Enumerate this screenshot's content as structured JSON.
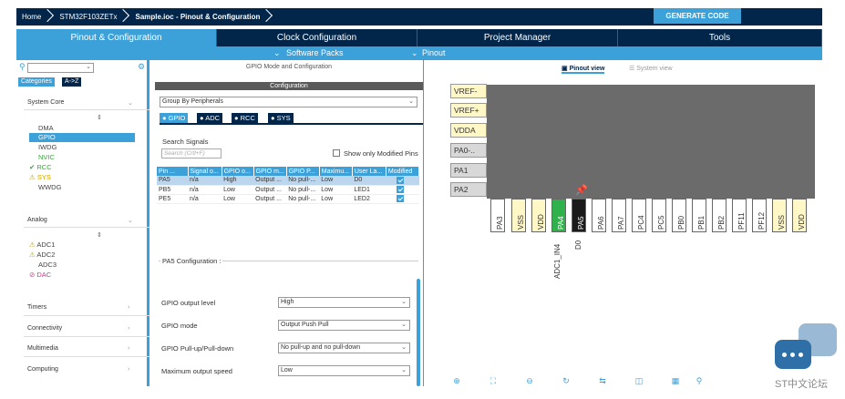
{
  "breadcrumb": [
    "Home",
    "STM32F103ZETx",
    "Sample.ioc - Pinout & Configuration"
  ],
  "generate_code": "GENERATE CODE",
  "tabs": [
    "Pinout & Configuration",
    "Clock Configuration",
    "Project Manager",
    "Tools"
  ],
  "subbar": {
    "software_packs": "Software Packs",
    "pinout": "Pinout"
  },
  "left": {
    "categories_label": "Categories",
    "az_label": "A->Z",
    "system_core": {
      "title": "System Core",
      "items": [
        "DMA",
        "GPIO",
        "IWDG",
        "NVIC",
        "RCC",
        "SYS",
        "WWDG"
      ]
    },
    "analog": {
      "title": "Analog",
      "items": [
        "ADC1",
        "ADC2",
        "ADC3",
        "DAC"
      ]
    },
    "groups": [
      "Timers",
      "Connectivity",
      "Multimedia",
      "Computing"
    ]
  },
  "mid": {
    "title": "GPIO Mode and Configuration",
    "configuration": "Configuration",
    "group_by": "Group By Peripherals",
    "ptabs": [
      "GPIO",
      "ADC",
      "RCC",
      "SYS"
    ],
    "search_label": "Search Signals",
    "search_placeholder": "Search (Crtl+F)",
    "show_modified": "Show only Modified Pins",
    "headers": [
      "Pin ...",
      "Signal o...",
      "GPIO o...",
      "GPIO m...",
      "GPIO P...",
      "Maximu...",
      "User La...",
      "Modified"
    ],
    "rows": [
      [
        "PA5",
        "n/a",
        "High",
        "Output ...",
        "No pull-...",
        "Low",
        "D0"
      ],
      [
        "PB5",
        "n/a",
        "Low",
        "Output ...",
        "No pull-...",
        "Low",
        "LED1"
      ],
      [
        "PE5",
        "n/a",
        "Low",
        "Output ...",
        "No pull-...",
        "Low",
        "LED2"
      ]
    ],
    "pa5_config": "PA5 Configuration :",
    "config": [
      {
        "label": "GPIO output level",
        "value": "High"
      },
      {
        "label": "GPIO mode",
        "value": "Output Push Pull"
      },
      {
        "label": "GPIO Pull-up/Pull-down",
        "value": "No pull-up and no pull-down"
      },
      {
        "label": "Maximum output speed",
        "value": "Low"
      }
    ]
  },
  "right": {
    "pinout_view": "Pinout view",
    "system_view": "System view",
    "left_pins": [
      "VREF-",
      "VREF+",
      "VDDA",
      "PA0-..",
      "PA1",
      "PA2"
    ],
    "bottom_pins": [
      "PA3",
      "VSS",
      "VDD",
      "PA4",
      "PA5",
      "PA6",
      "PA7",
      "PC4",
      "PC5",
      "PB0",
      "PB1",
      "PB2",
      "PF11",
      "PF12",
      "VSS",
      "VDD"
    ],
    "signal_pa4": "ADC1_IN4",
    "signal_pa5": "D0"
  },
  "watermark": "ST中文论坛"
}
